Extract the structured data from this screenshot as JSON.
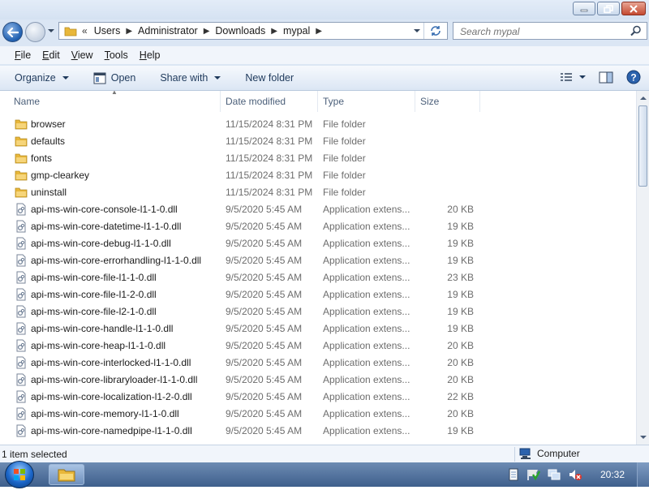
{
  "window": {
    "controls": [
      "minimize",
      "maximize",
      "close"
    ]
  },
  "nav": {
    "breadcrumb_prefix": "«",
    "breadcrumb": [
      "Users",
      "Administrator",
      "Downloads",
      "mypal"
    ],
    "search_placeholder": "Search mypal"
  },
  "menu": [
    "File",
    "Edit",
    "View",
    "Tools",
    "Help"
  ],
  "menu_underline": [
    "F",
    "E",
    "V",
    "T",
    "H"
  ],
  "commands": {
    "organize": "Organize",
    "open": "Open",
    "share_with": "Share with",
    "new_folder": "New folder"
  },
  "columns": {
    "name": "Name",
    "date": "Date modified",
    "type": "Type",
    "size": "Size"
  },
  "files": [
    {
      "name": "browser",
      "date": "11/15/2024 8:31 PM",
      "type": "File folder",
      "size": "",
      "kind": "folder"
    },
    {
      "name": "defaults",
      "date": "11/15/2024 8:31 PM",
      "type": "File folder",
      "size": "",
      "kind": "folder"
    },
    {
      "name": "fonts",
      "date": "11/15/2024 8:31 PM",
      "type": "File folder",
      "size": "",
      "kind": "folder"
    },
    {
      "name": "gmp-clearkey",
      "date": "11/15/2024 8:31 PM",
      "type": "File folder",
      "size": "",
      "kind": "folder"
    },
    {
      "name": "uninstall",
      "date": "11/15/2024 8:31 PM",
      "type": "File folder",
      "size": "",
      "kind": "folder"
    },
    {
      "name": "api-ms-win-core-console-l1-1-0.dll",
      "date": "9/5/2020 5:45 AM",
      "type": "Application extens...",
      "size": "20 KB",
      "kind": "dll"
    },
    {
      "name": "api-ms-win-core-datetime-l1-1-0.dll",
      "date": "9/5/2020 5:45 AM",
      "type": "Application extens...",
      "size": "19 KB",
      "kind": "dll"
    },
    {
      "name": "api-ms-win-core-debug-l1-1-0.dll",
      "date": "9/5/2020 5:45 AM",
      "type": "Application extens...",
      "size": "19 KB",
      "kind": "dll"
    },
    {
      "name": "api-ms-win-core-errorhandling-l1-1-0.dll",
      "date": "9/5/2020 5:45 AM",
      "type": "Application extens...",
      "size": "19 KB",
      "kind": "dll"
    },
    {
      "name": "api-ms-win-core-file-l1-1-0.dll",
      "date": "9/5/2020 5:45 AM",
      "type": "Application extens...",
      "size": "23 KB",
      "kind": "dll"
    },
    {
      "name": "api-ms-win-core-file-l1-2-0.dll",
      "date": "9/5/2020 5:45 AM",
      "type": "Application extens...",
      "size": "19 KB",
      "kind": "dll"
    },
    {
      "name": "api-ms-win-core-file-l2-1-0.dll",
      "date": "9/5/2020 5:45 AM",
      "type": "Application extens...",
      "size": "19 KB",
      "kind": "dll"
    },
    {
      "name": "api-ms-win-core-handle-l1-1-0.dll",
      "date": "9/5/2020 5:45 AM",
      "type": "Application extens...",
      "size": "19 KB",
      "kind": "dll"
    },
    {
      "name": "api-ms-win-core-heap-l1-1-0.dll",
      "date": "9/5/2020 5:45 AM",
      "type": "Application extens...",
      "size": "20 KB",
      "kind": "dll"
    },
    {
      "name": "api-ms-win-core-interlocked-l1-1-0.dll",
      "date": "9/5/2020 5:45 AM",
      "type": "Application extens...",
      "size": "20 KB",
      "kind": "dll"
    },
    {
      "name": "api-ms-win-core-libraryloader-l1-1-0.dll",
      "date": "9/5/2020 5:45 AM",
      "type": "Application extens...",
      "size": "20 KB",
      "kind": "dll"
    },
    {
      "name": "api-ms-win-core-localization-l1-2-0.dll",
      "date": "9/5/2020 5:45 AM",
      "type": "Application extens...",
      "size": "22 KB",
      "kind": "dll"
    },
    {
      "name": "api-ms-win-core-memory-l1-1-0.dll",
      "date": "9/5/2020 5:45 AM",
      "type": "Application extens...",
      "size": "20 KB",
      "kind": "dll"
    },
    {
      "name": "api-ms-win-core-namedpipe-l1-1-0.dll",
      "date": "9/5/2020 5:45 AM",
      "type": "Application extens...",
      "size": "19 KB",
      "kind": "dll"
    }
  ],
  "status": {
    "left": "1 item selected",
    "right": "Computer"
  },
  "taskbar": {
    "clock": "20:32"
  },
  "colors": {
    "folder": "#e8b73a",
    "accent": "#1e395b",
    "window_bg": "#dbe6f4"
  }
}
